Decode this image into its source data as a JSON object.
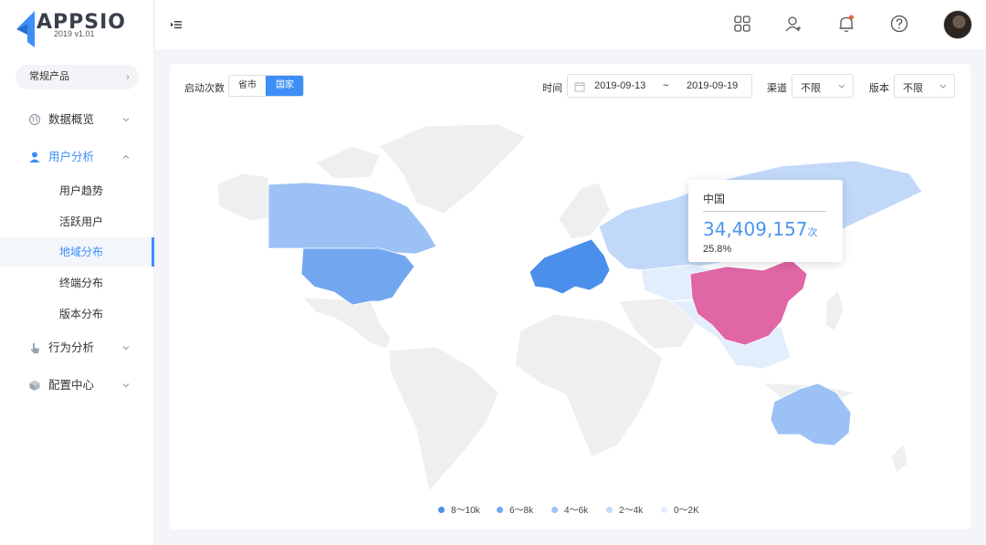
{
  "brand": {
    "name": "APPSIO",
    "version": "2019 v1.01"
  },
  "sidebar": {
    "product": "常规产品",
    "menu": [
      {
        "label": "数据概览",
        "icon": "globe-icon"
      },
      {
        "label": "用户分析",
        "icon": "user-icon"
      },
      {
        "label": "行为分析",
        "icon": "pointer-icon"
      },
      {
        "label": "配置中心",
        "icon": "box-icon"
      }
    ],
    "submenu": [
      "用户趋势",
      "活跃用户",
      "地域分布",
      "终端分布",
      "版本分布"
    ]
  },
  "filters": {
    "launch_label": "启动次数",
    "seg_province": "省市",
    "seg_country": "国家",
    "time_label": "时间",
    "date_start": "2019-09-13",
    "date_sep": "~",
    "date_end": "2019-09-19",
    "channel_label": "渠道",
    "channel_value": "不限",
    "version_label": "版本",
    "version_value": "不限"
  },
  "tooltip": {
    "name": "中国",
    "value": "34,409,157",
    "unit": "次",
    "percent": "25.8%"
  },
  "legend": [
    {
      "label": "8～10k",
      "color": "#4a8fec"
    },
    {
      "label": "6～8k",
      "color": "#72a7f0"
    },
    {
      "label": "4～6k",
      "color": "#9cc1f5"
    },
    {
      "label": "2～4k",
      "color": "#c1d8f9"
    },
    {
      "label": "0～2K",
      "color": "#e3eefc"
    }
  ],
  "colors": {
    "accent": "#3e8ef7",
    "highlight": "#e066a6",
    "land": "#f0f0f0"
  }
}
